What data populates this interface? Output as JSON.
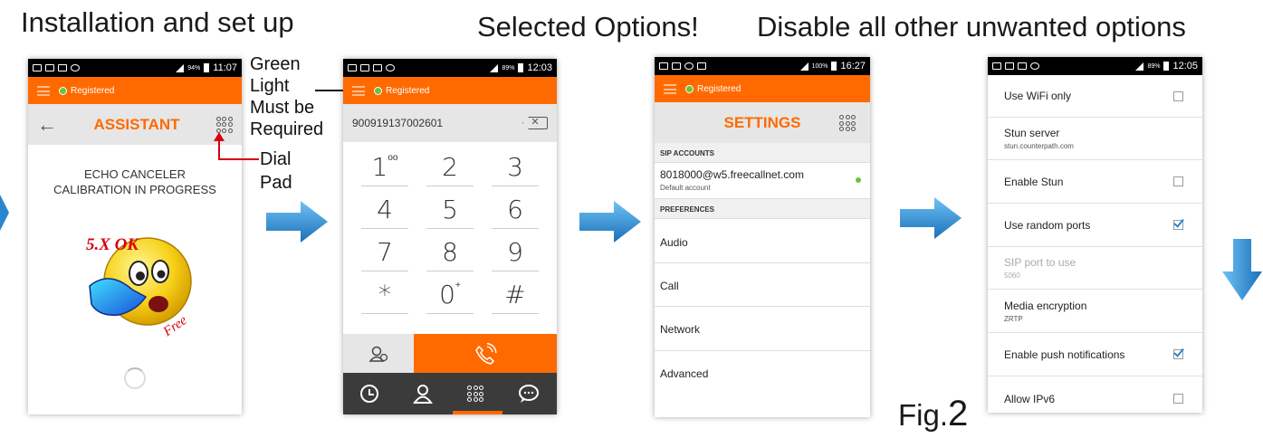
{
  "headings": {
    "install": "Installation and set up",
    "selected": "Selected Options!",
    "disable": "Disable all other unwanted options"
  },
  "annotations": {
    "green_light": [
      "Green",
      "Light",
      "Must be",
      "Required"
    ],
    "dial_pad": [
      "Dial",
      "Pad"
    ],
    "fig": "Fig.",
    "fig_num": "2"
  },
  "phone1": {
    "status_time": "11:07",
    "status_pct": "94%",
    "registered": "Registered",
    "title": "ASSISTANT",
    "message_line1": "ECHO CANCELER",
    "message_line2": "CALIBRATION IN PROGRESS",
    "logo_text": "5.X OK",
    "logo_free": "Free"
  },
  "phone2": {
    "status_time": "12:03",
    "status_pct": "89%",
    "registered": "Registered",
    "number": "900919137002601",
    "keys": [
      {
        "digit": "1",
        "sub": "oo"
      },
      {
        "digit": "2",
        "sub": ""
      },
      {
        "digit": "3",
        "sub": ""
      },
      {
        "digit": "4",
        "sub": ""
      },
      {
        "digit": "5",
        "sub": ""
      },
      {
        "digit": "6",
        "sub": ""
      },
      {
        "digit": "7",
        "sub": ""
      },
      {
        "digit": "8",
        "sub": ""
      },
      {
        "digit": "9",
        "sub": ""
      },
      {
        "digit": "*",
        "sub": ""
      },
      {
        "digit": "0",
        "sub": "+"
      },
      {
        "digit": "#",
        "sub": ""
      }
    ]
  },
  "phone3": {
    "status_time": "16:27",
    "status_pct": "100%",
    "registered": "Registered",
    "title": "SETTINGS",
    "section_sip": "SIP ACCOUNTS",
    "account": "8018000@w5.freecallnet.com",
    "account_sub": "Default account",
    "section_prefs": "PREFERENCES",
    "items": [
      "Audio",
      "Call",
      "Network",
      "Advanced"
    ]
  },
  "phone4": {
    "status_time": "12:05",
    "status_pct": "89%",
    "rows": [
      {
        "label": "Use WiFi only",
        "sub": "",
        "checked": false,
        "checkbox": true,
        "disabled": false
      },
      {
        "label": "Stun server",
        "sub": "stun.counterpath.com",
        "checked": false,
        "checkbox": false,
        "disabled": false
      },
      {
        "label": "Enable Stun",
        "sub": "",
        "checked": false,
        "checkbox": true,
        "disabled": false
      },
      {
        "label": "Use random ports",
        "sub": "",
        "checked": true,
        "checkbox": true,
        "disabled": false
      },
      {
        "label": "SIP port to use",
        "sub": "5060",
        "checked": false,
        "checkbox": false,
        "disabled": true
      },
      {
        "label": "Media encryption",
        "sub": "ZRTP",
        "checked": false,
        "checkbox": false,
        "disabled": false
      },
      {
        "label": "Enable push notifications",
        "sub": "",
        "checked": true,
        "checkbox": true,
        "disabled": false
      },
      {
        "label": "Allow IPv6",
        "sub": "",
        "checked": false,
        "checkbox": true,
        "disabled": false
      }
    ]
  },
  "colors": {
    "accent": "#ff6a00",
    "registered_led": "#6cc33a",
    "arrow_blue": "#2a86cf",
    "dark_nav": "#3b3b3b",
    "annotation_red": "#d9000d"
  }
}
